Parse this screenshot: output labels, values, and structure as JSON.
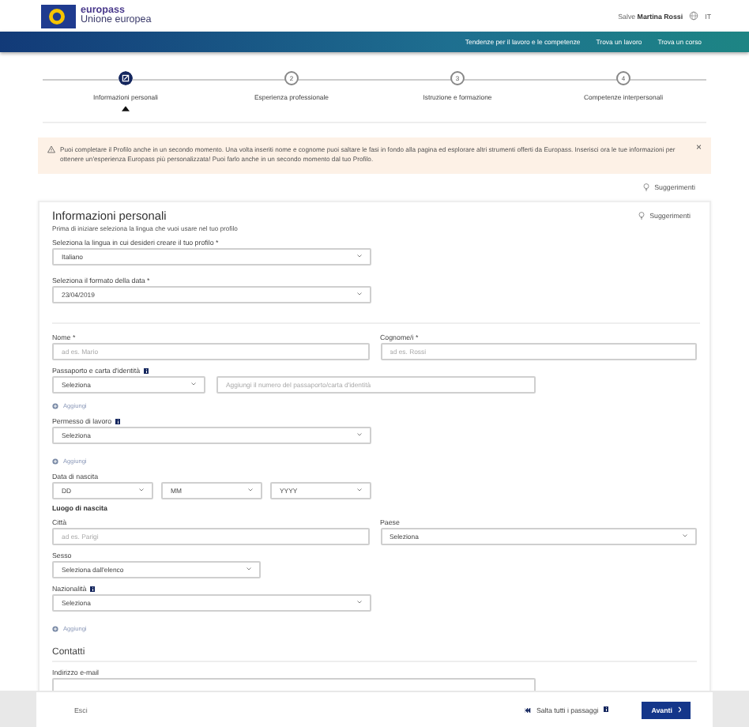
{
  "header": {
    "brand": "europass",
    "subbrand": "Unione europea",
    "greeting": "Salve",
    "user": "Martina Rossi",
    "language": "IT"
  },
  "nav": [
    "Tendenze per il lavoro e le competenze",
    "Trova un lavoro",
    "Trova un corso"
  ],
  "steps": [
    {
      "label": "Informazioni personali",
      "selected": true
    },
    {
      "number": "2",
      "label": "Esperienza professionale",
      "selected": false
    },
    {
      "number": "3",
      "label": "Istruzione e formazione",
      "selected": false
    },
    {
      "number": "4",
      "label": "Competenze interpersonali",
      "selected": false
    }
  ],
  "notice": {
    "text": "Puoi completare il Profilo anche in un secondo momento. Una volta inseriti nome e cognome puoi saltare le fasi in fondo alla pagina ed esplorare altri strumenti offerti da Europass. Inserisci ora le tue informazioni per ottenere un'esperienza Europass più personalizzata! Puoi farlo anche in un secondo momento dal tuo Profilo.",
    "close": "×"
  },
  "tips_link": "Suggerimenti",
  "card": {
    "title": "Informazioni personali",
    "subtitle": "Prima di iniziare seleziona la lingua che vuoi usare nel tuo profilo",
    "tips_link": "Suggerimenti",
    "rows": [
      {
        "kind": "single",
        "label": "Seleziona la lingua in cui desideri creare il tuo profilo",
        "mark": "*",
        "fields": [
          {
            "kind": "select",
            "value": "Italiano"
          }
        ]
      },
      {
        "kind": "single",
        "label": "Seleziona il formato della data",
        "mark": "*",
        "fields": [
          {
            "kind": "select",
            "value": "23/04/2019"
          }
        ]
      },
      {
        "kind": "divider"
      },
      {
        "kind": "pair",
        "fields": [
          {
            "kind": "input",
            "label": "Nome",
            "mark": "*",
            "placeholder": "ad es. Mario"
          },
          {
            "kind": "input",
            "label": "Cognome/i",
            "mark": "*",
            "placeholder": "ad es. Rossi"
          }
        ]
      },
      {
        "kind": "id",
        "label": "Passaporto e carta d'identità",
        "info": true,
        "fields": [
          {
            "kind": "select",
            "value": "Seleziona"
          },
          {
            "kind": "input",
            "placeholder": "Aggiungi il numero del passaporto/carta d'identità"
          }
        ]
      },
      {
        "kind": "add",
        "text": "Aggiungi"
      },
      {
        "kind": "single",
        "label": "Permesso di lavoro",
        "info": true,
        "fields": [
          {
            "kind": "select",
            "value": "Seleziona"
          }
        ]
      },
      {
        "kind": "add",
        "text": "Aggiungi"
      },
      {
        "kind": "date",
        "label": "Data di nascita",
        "fields": [
          {
            "kind": "select",
            "value": "DD"
          },
          {
            "kind": "select",
            "value": "MM"
          },
          {
            "kind": "select",
            "value": "YYYY"
          }
        ]
      },
      {
        "kind": "heading",
        "text": "Luogo di nascita"
      },
      {
        "kind": "pair",
        "fields": [
          {
            "kind": "input",
            "label": "Città",
            "placeholder": "ad es. Parigi"
          },
          {
            "kind": "select",
            "label": "Paese",
            "value": "Seleziona"
          }
        ]
      },
      {
        "kind": "short",
        "label": "Sesso",
        "fields": [
          {
            "kind": "select",
            "value": "Seleziona dall'elenco"
          }
        ]
      },
      {
        "kind": "single",
        "label": "Nazionalità",
        "info": true,
        "fields": [
          {
            "kind": "select",
            "value": "Seleziona"
          }
        ]
      },
      {
        "kind": "add",
        "text": "Aggiungi"
      },
      {
        "kind": "section",
        "text": "Contatti"
      },
      {
        "kind": "wide",
        "label": "Indirizzo e-mail",
        "fields": [
          {
            "kind": "input"
          }
        ]
      }
    ]
  },
  "footer": {
    "exit": "Esci",
    "skip": "Salta tutti i passaggi",
    "next": "Avanti"
  }
}
